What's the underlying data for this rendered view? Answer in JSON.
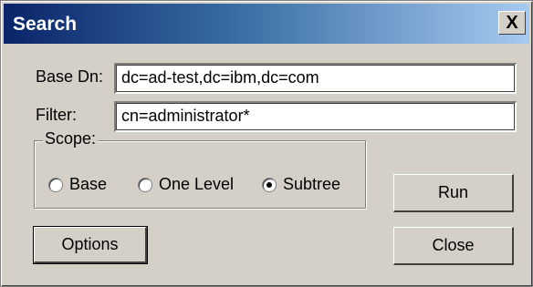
{
  "window": {
    "title": "Search",
    "close_glyph": "X"
  },
  "form": {
    "base_dn_label": "Base Dn:",
    "base_dn_value": "dc=ad-test,dc=ibm,dc=com",
    "filter_label": "Filter:",
    "filter_value": "cn=administrator*"
  },
  "scope": {
    "legend": "Scope:",
    "options": [
      {
        "label": "Base",
        "selected": false
      },
      {
        "label": "One Level",
        "selected": false
      },
      {
        "label": "Subtree",
        "selected": true
      }
    ]
  },
  "buttons": {
    "run": "Run",
    "options": "Options",
    "close": "Close"
  }
}
